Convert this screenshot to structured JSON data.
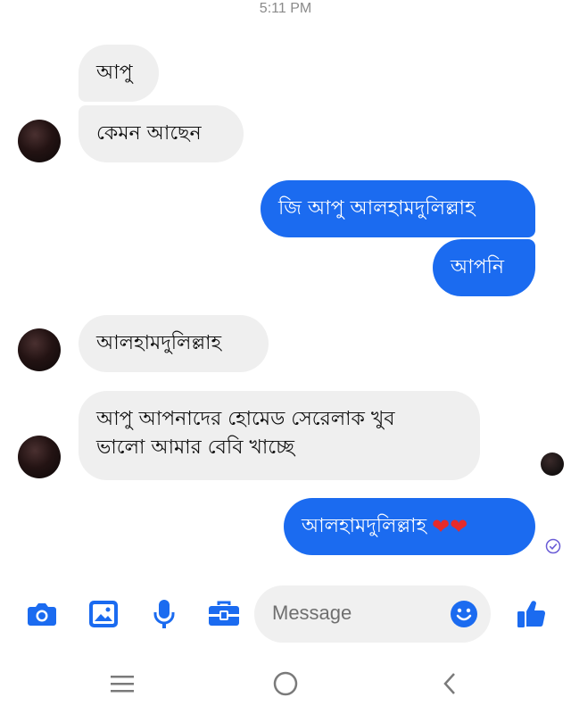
{
  "header": {
    "time": "5:11 PM"
  },
  "messages": [
    {
      "sender": "them",
      "text": "আপু"
    },
    {
      "sender": "them",
      "text": "কেমন আছেন"
    },
    {
      "sender": "me",
      "text": "জি আপু আলহামদুলিল্লাহ"
    },
    {
      "sender": "me",
      "text": "আপনি"
    },
    {
      "sender": "them",
      "text": "আলহামদুলিল্লাহ"
    },
    {
      "sender": "them",
      "text": "আপু আপনাদের হোমেড সেরেলাক খুব",
      "text2": "ভালো আমার বেবি খাচ্ছে"
    },
    {
      "sender": "me",
      "text": "আলহামদুলিল্লাহ",
      "emoji": "❤❤"
    }
  ],
  "composer": {
    "placeholder": "Message",
    "tools": [
      "camera-icon",
      "gallery-icon",
      "microphone-icon",
      "toolbox-icon"
    ],
    "emoji_icon": "smiley-icon",
    "like_icon": "thumbs-up-icon"
  },
  "navbar": {
    "items": [
      "menu-icon",
      "home-icon",
      "back-icon"
    ]
  },
  "colors": {
    "accent": "#1b6bf0",
    "incoming_bubble": "#efefef",
    "heart": "#e52b2b"
  }
}
